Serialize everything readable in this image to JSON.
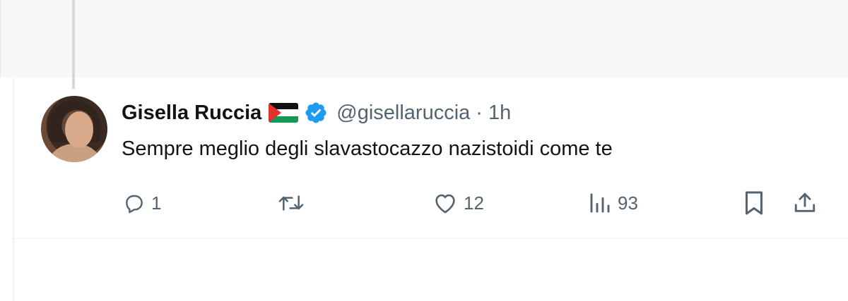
{
  "tweet": {
    "author_name": "Gisella Ruccia",
    "flag_icon": "palestine-flag-icon",
    "verified_icon": "verified-badge-icon",
    "handle": "@gisellaruccia",
    "separator": "·",
    "time": "1h",
    "text": "Sempre meglio degli slavastocazzo nazistoidi come te",
    "actions": {
      "reply_count": "1",
      "retweet_count": "",
      "like_count": "12",
      "views_count": "93"
    }
  },
  "colors": {
    "text_primary": "#0f1419",
    "text_secondary": "#536471",
    "verified_blue": "#1d9bf0",
    "divider": "#eff3f4"
  }
}
